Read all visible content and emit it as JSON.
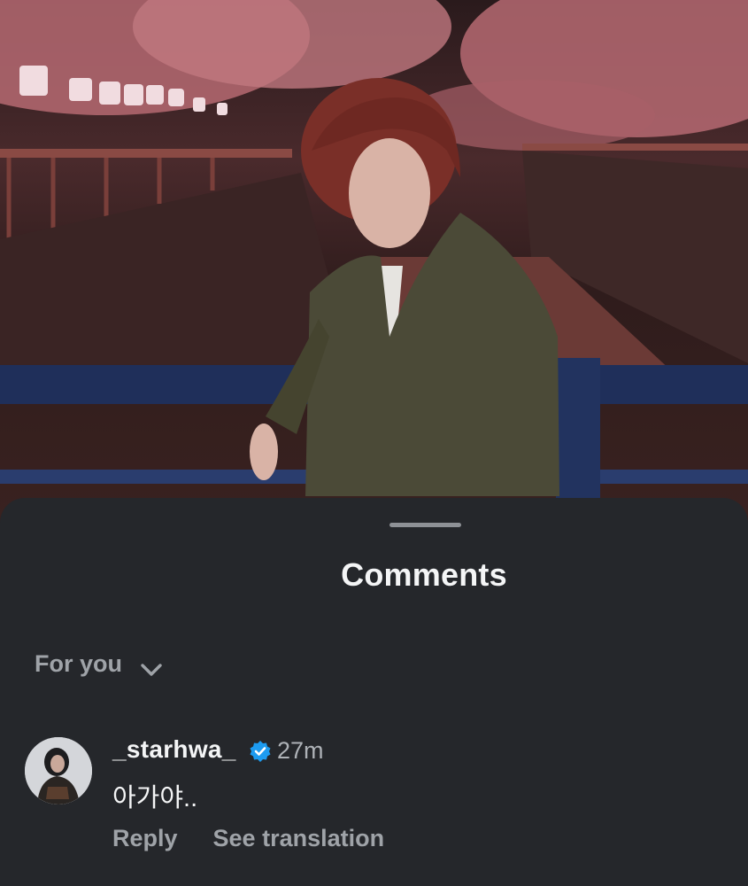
{
  "sheet": {
    "title": "Comments",
    "filter_label": "For you"
  },
  "comment": {
    "username": "_starhwa_",
    "time": "27m",
    "text": "아가야..",
    "reply_label": "Reply",
    "translate_label": "See translation"
  },
  "icons": {
    "filter_dropdown": "chevron-down-icon",
    "verified": "verified-badge-icon"
  },
  "colors": {
    "sheet_background": "#25272b",
    "primary_text": "#f4f5f6",
    "secondary_text": "#9fa3a8",
    "verified_blue": "#1d9bf0"
  }
}
